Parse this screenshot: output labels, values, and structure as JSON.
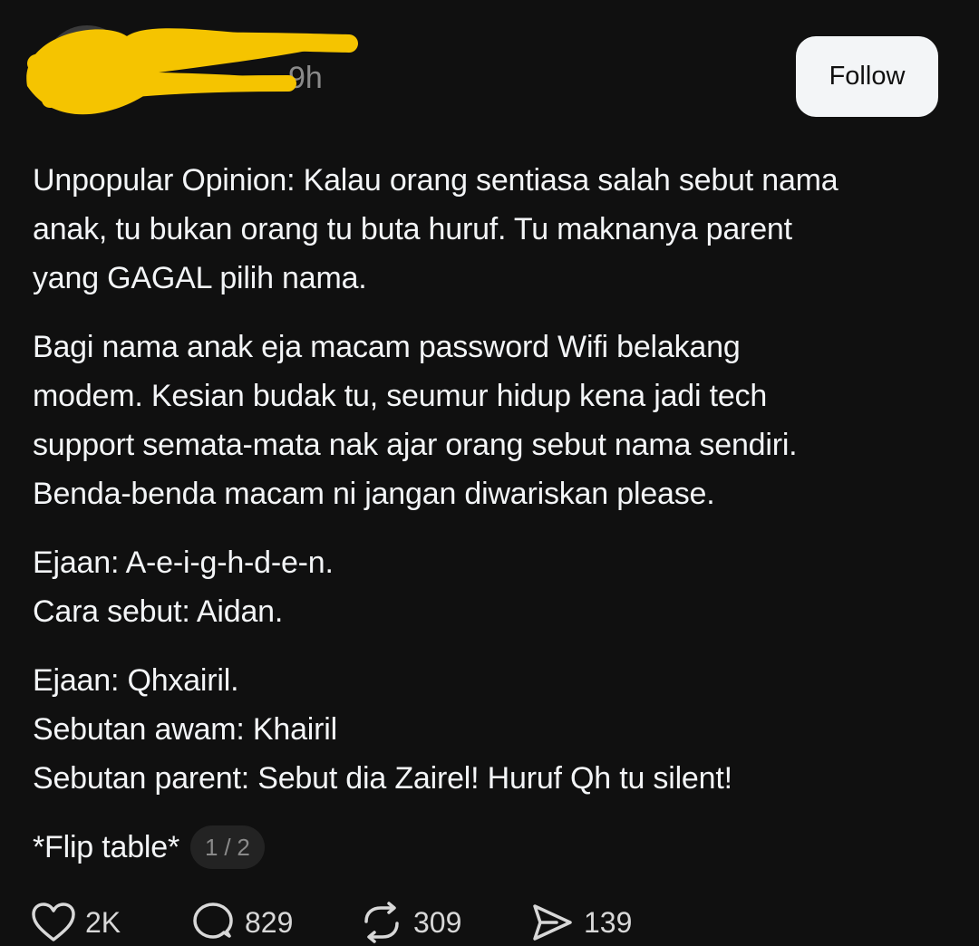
{
  "header": {
    "timestamp": "9h",
    "follow_label": "Follow"
  },
  "post": {
    "paragraphs": [
      [
        "Unpopular Opinion: Kalau orang sentiasa salah sebut nama",
        "anak, tu bukan orang tu buta huruf. Tu maknanya parent",
        "yang GAGAL pilih nama."
      ],
      [
        "Bagi nama anak eja macam password Wifi belakang",
        "modem. Kesian budak tu, seumur hidup kena jadi tech",
        "support semata-mata nak ajar orang sebut nama sendiri.",
        "Benda-benda macam ni jangan diwariskan please."
      ],
      [
        "Ejaan: A-e-i-g-h-d-e-n.",
        "Cara sebut: Aidan."
      ],
      [
        "Ejaan: Qhxairil.",
        "Sebutan awam: Khairil",
        "Sebutan parent: Sebut dia Zairel! Huruf Qh tu silent!"
      ]
    ],
    "last_line": "*Flip table*",
    "page_indicator": "1 / 2"
  },
  "actions": {
    "like": {
      "icon": "heart-icon",
      "count": "2K"
    },
    "reply": {
      "icon": "speech-bubble-icon",
      "count": "829"
    },
    "repost": {
      "icon": "repost-icon",
      "count": "309"
    },
    "share": {
      "icon": "send-icon",
      "count": "139"
    }
  },
  "colors": {
    "background": "#101010",
    "text": "#f3f5f7",
    "muted": "#8a8a8a",
    "follow_bg": "#f3f5f7",
    "redaction": "#f5c400"
  }
}
